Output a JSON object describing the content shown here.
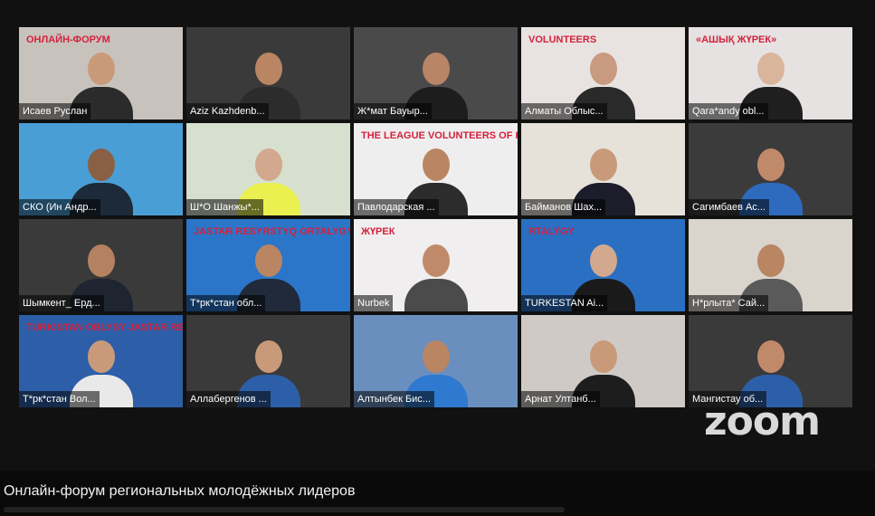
{
  "meeting": {
    "app_logo": "zoom",
    "caption": "Онлайн-форум региональных молодёжных лидеров"
  },
  "participants": [
    {
      "name": "Исаев Руслан",
      "active": true,
      "bg": "#c8c2bc",
      "skin": "#c99a7a",
      "clothes": "#2b2b2b",
      "sign": "ОНЛАЙН-ФОРУМ"
    },
    {
      "name": "Aziz Kazhdenb...",
      "active": false,
      "bg": "#3a3a3a",
      "skin": "#b98563",
      "clothes": "#2c2c2c",
      "sign": ""
    },
    {
      "name": "Ж*мат Бауыр...",
      "active": false,
      "bg": "#4a4a4a",
      "skin": "#b88566",
      "clothes": "#1d1d1d",
      "sign": ""
    },
    {
      "name": "Алматы Облыс...",
      "active": false,
      "bg": "#e8e3e0",
      "skin": "#c89a80",
      "clothes": "#2a2a2a",
      "sign": "VOLUNTEERS"
    },
    {
      "name": "Qara*andy obl...",
      "active": false,
      "bg": "#e6e2e2",
      "skin": "#d9b59c",
      "clothes": "#1f1f1f",
      "sign": "«АШЫҚ ЖҮРЕК»"
    },
    {
      "name": "СКО (Ин Андр...",
      "active": false,
      "bg": "#4a9ed6",
      "skin": "#8a6045",
      "clothes": "#1d2a3a",
      "sign": ""
    },
    {
      "name": "Ш*О Шанжы*...",
      "active": false,
      "bg": "#d7e0cf",
      "skin": "#d2a98e",
      "clothes": "#e9f04f",
      "sign": ""
    },
    {
      "name": "Павлодарская ...",
      "active": false,
      "bg": "#efeeee",
      "skin": "#b98563",
      "clothes": "#2c2c2c",
      "sign": "THE LEAGUE VOLUNTEERS OF KAZAKHS"
    },
    {
      "name": "Байманов Шах...",
      "active": false,
      "bg": "#e6e2da",
      "skin": "#c99a7a",
      "clothes": "#1c1c2a",
      "sign": ""
    },
    {
      "name": "Сагимбаев Ас...",
      "active": false,
      "bg": "#3b3b3b",
      "skin": "#c08a6a",
      "clothes": "#2e6bbf",
      "sign": ""
    },
    {
      "name": "Шымкент_ Ерд...",
      "active": false,
      "bg": "#3a3a3a",
      "skin": "#b48260",
      "clothes": "#1e2430",
      "sign": ""
    },
    {
      "name": "Т*рк*стан обл...",
      "active": false,
      "bg": "#2b76c9",
      "skin": "#b98563",
      "clothes": "#202a3a",
      "sign": "JASTAR RESYRSTYQ ORTALYGY"
    },
    {
      "name": "Nurbek",
      "active": false,
      "bg": "#f0eeee",
      "skin": "#c08a6a",
      "clothes": "#4b4b4b",
      "sign": "ЖҮРЕК"
    },
    {
      "name": "TURKESTAN Ai...",
      "active": false,
      "bg": "#2a6fc2",
      "skin": "#d2a98e",
      "clothes": "#1a1a1a",
      "sign": "RTALYGY"
    },
    {
      "name": "Н*рлыта* Сай...",
      "active": false,
      "bg": "#d9d4cc",
      "skin": "#b98563",
      "clothes": "#5a5a5a",
      "sign": ""
    },
    {
      "name": "Т*рк*стан Вол...",
      "active": false,
      "bg": "#2d5fa8",
      "skin": "#c99a7a",
      "clothes": "#e9e9e9",
      "sign": "TURKISTAN OBLYSY JASTAR RESYRSTYQ ORTALYGY"
    },
    {
      "name": "Аллабергенов ...",
      "active": false,
      "bg": "#3a3a3a",
      "skin": "#c99a7a",
      "clothes": "#2d5fa8",
      "sign": ""
    },
    {
      "name": "Алтынбек Бис...",
      "active": false,
      "bg": "#6a8fbf",
      "skin": "#b98563",
      "clothes": "#2f7ad0",
      "sign": ""
    },
    {
      "name": "Арнат Ултанб...",
      "active": false,
      "bg": "#cfcac6",
      "skin": "#c99a7a",
      "clothes": "#1d1d1d",
      "sign": ""
    },
    {
      "name": "Мангистау об...",
      "active": false,
      "bg": "#3a3a3a",
      "skin": "#c08a6a",
      "clothes": "#2d5fa8",
      "sign": ""
    }
  ]
}
